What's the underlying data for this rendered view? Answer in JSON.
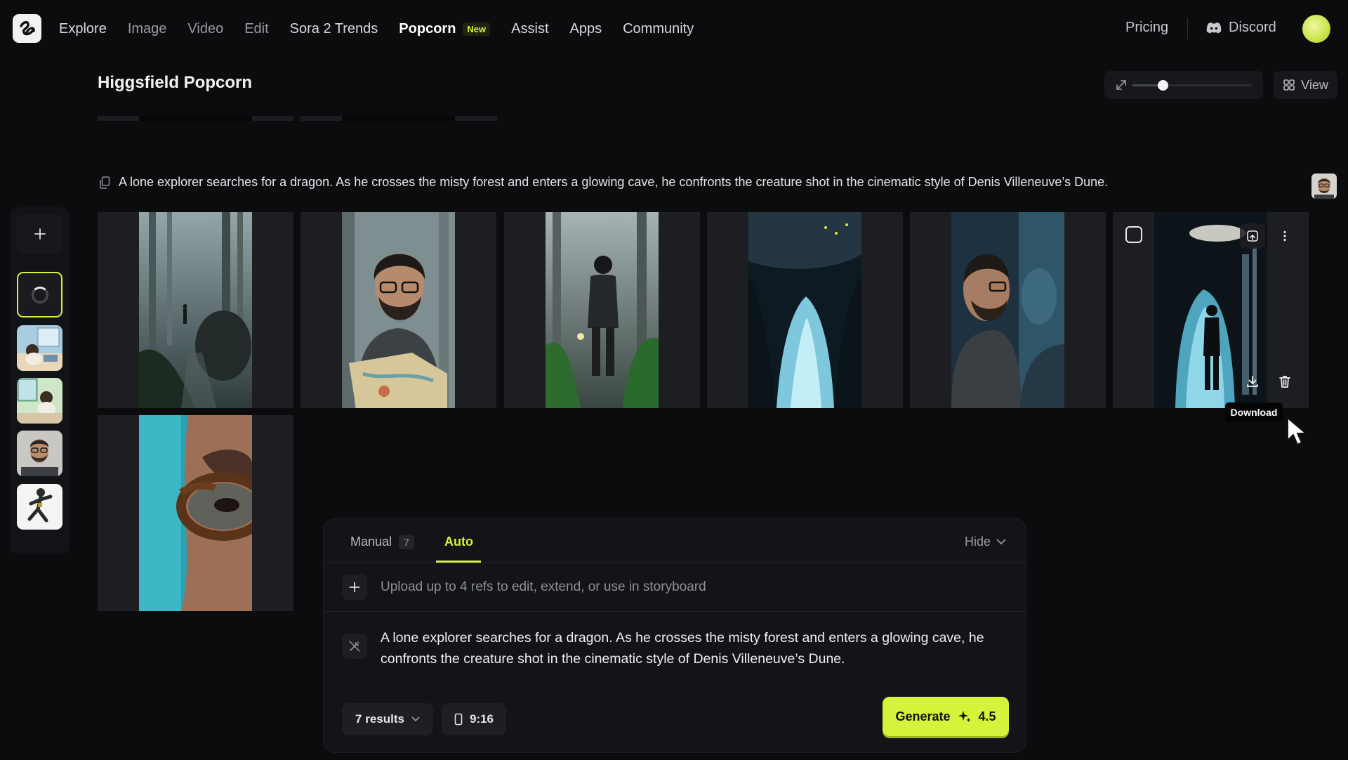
{
  "nav": {
    "items": [
      {
        "label": "Explore",
        "style": "strong"
      },
      {
        "label": "Image",
        "style": "dim"
      },
      {
        "label": "Video",
        "style": "dim"
      },
      {
        "label": "Edit",
        "style": "dim"
      },
      {
        "label": "Sora 2 Trends",
        "style": "strong"
      },
      {
        "label": "Popcorn",
        "style": "active",
        "badge": "New"
      },
      {
        "label": "Assist",
        "style": "strong"
      },
      {
        "label": "Apps",
        "style": "strong"
      },
      {
        "label": "Community",
        "style": "strong"
      }
    ],
    "pricing": "Pricing",
    "discord": "Discord"
  },
  "page": {
    "title": "Higgsfield Popcorn",
    "view_label": "View",
    "zoom_level": 0.25
  },
  "prompt": {
    "text": "A lone explorer searches for a dragon. As he crosses the misty forest and enters a glowing cave, he confronts the creature shot in the cinematic style of Denis Villeneuve’s Dune."
  },
  "hover": {
    "tooltip": "Download"
  },
  "composer": {
    "tabs": {
      "manual_label": "Manual",
      "manual_count": "7",
      "auto_label": "Auto"
    },
    "hide_label": "Hide",
    "upload_placeholder": "Upload up to 4 refs to edit, extend, or use in storyboard",
    "prompt_text": "A lone explorer searches for a dragon. As he crosses the misty forest and enters a glowing cave, he confronts the creature shot in the cinematic style of Denis Villeneuve’s Dune.",
    "results_label": "7 results",
    "ratio_label": "9:16",
    "generate_label": "Generate",
    "generate_cost": "4.5"
  },
  "colors": {
    "accent": "#d7f23a",
    "background": "#0b0c0e",
    "panel": "#131417"
  }
}
